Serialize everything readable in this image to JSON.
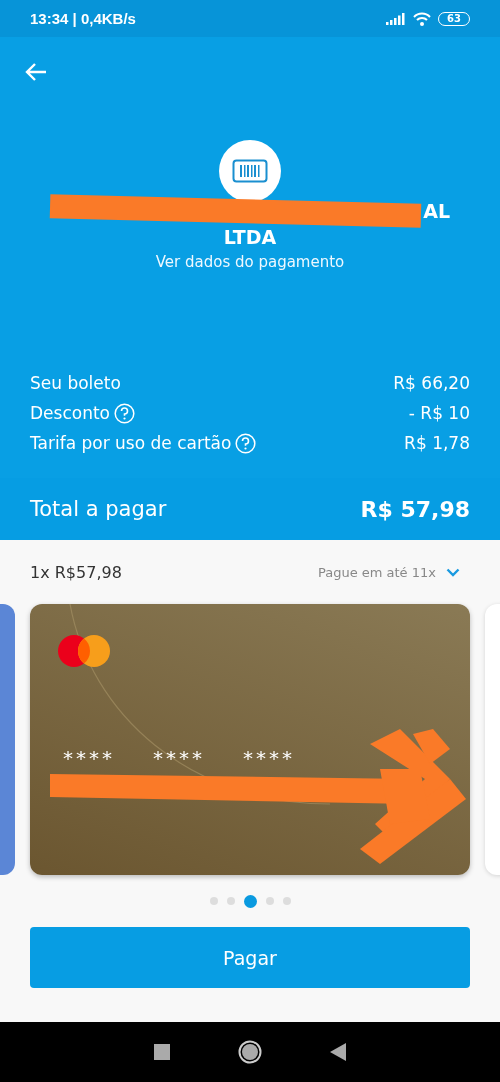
{
  "status_bar": {
    "time": "13:34 | 0,4KB/s",
    "battery": "63"
  },
  "merchant": {
    "name_visible_end": "AL",
    "name_line_2": "LTDA",
    "details_link": "Ver dados do pagamento"
  },
  "summary": [
    {
      "label": "Seu boleto",
      "value": "R$ 66,20",
      "help": false
    },
    {
      "label": "Desconto",
      "value": "- R$ 10",
      "help": true
    },
    {
      "label": "Tarifa por uso de cartão",
      "value": "R$ 1,78",
      "help": true
    }
  ],
  "total": {
    "label": "Total a pagar",
    "value": "R$ 57,98"
  },
  "installments": {
    "selected": "1x R$57,98",
    "hint": "Pague em até 11x"
  },
  "card": {
    "number_groups": [
      "****",
      "****",
      "****"
    ]
  },
  "carousel_dots": [
    {
      "selected": false
    },
    {
      "selected": false
    },
    {
      "selected": true
    },
    {
      "selected": false
    },
    {
      "selected": false
    }
  ],
  "pay_button": "Pagar"
}
